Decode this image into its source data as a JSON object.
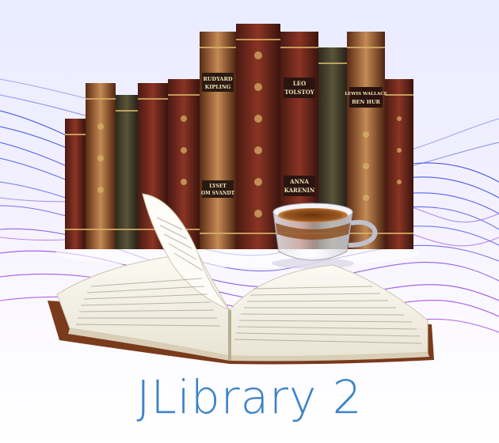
{
  "app": {
    "title": "JLibrary 2"
  },
  "books": [
    {
      "label": "RUDYARD",
      "label2": "KIPLING"
    },
    {
      "label": "LEO",
      "label2": "TOLSTOY"
    },
    {
      "label": "LEWIS WALLACE",
      "label2": "BEN HUR"
    },
    {
      "label": "ANNA",
      "label2": "KARENIN"
    },
    {
      "label": "LYSET",
      "label2": "OM SVANDT"
    }
  ],
  "colors": {
    "title": "#3b82c8",
    "wave1": "#2b3fd6",
    "wave2": "#8a3ce0"
  },
  "icons": {
    "cup": "coffee-cup-icon",
    "book": "open-book-icon"
  }
}
